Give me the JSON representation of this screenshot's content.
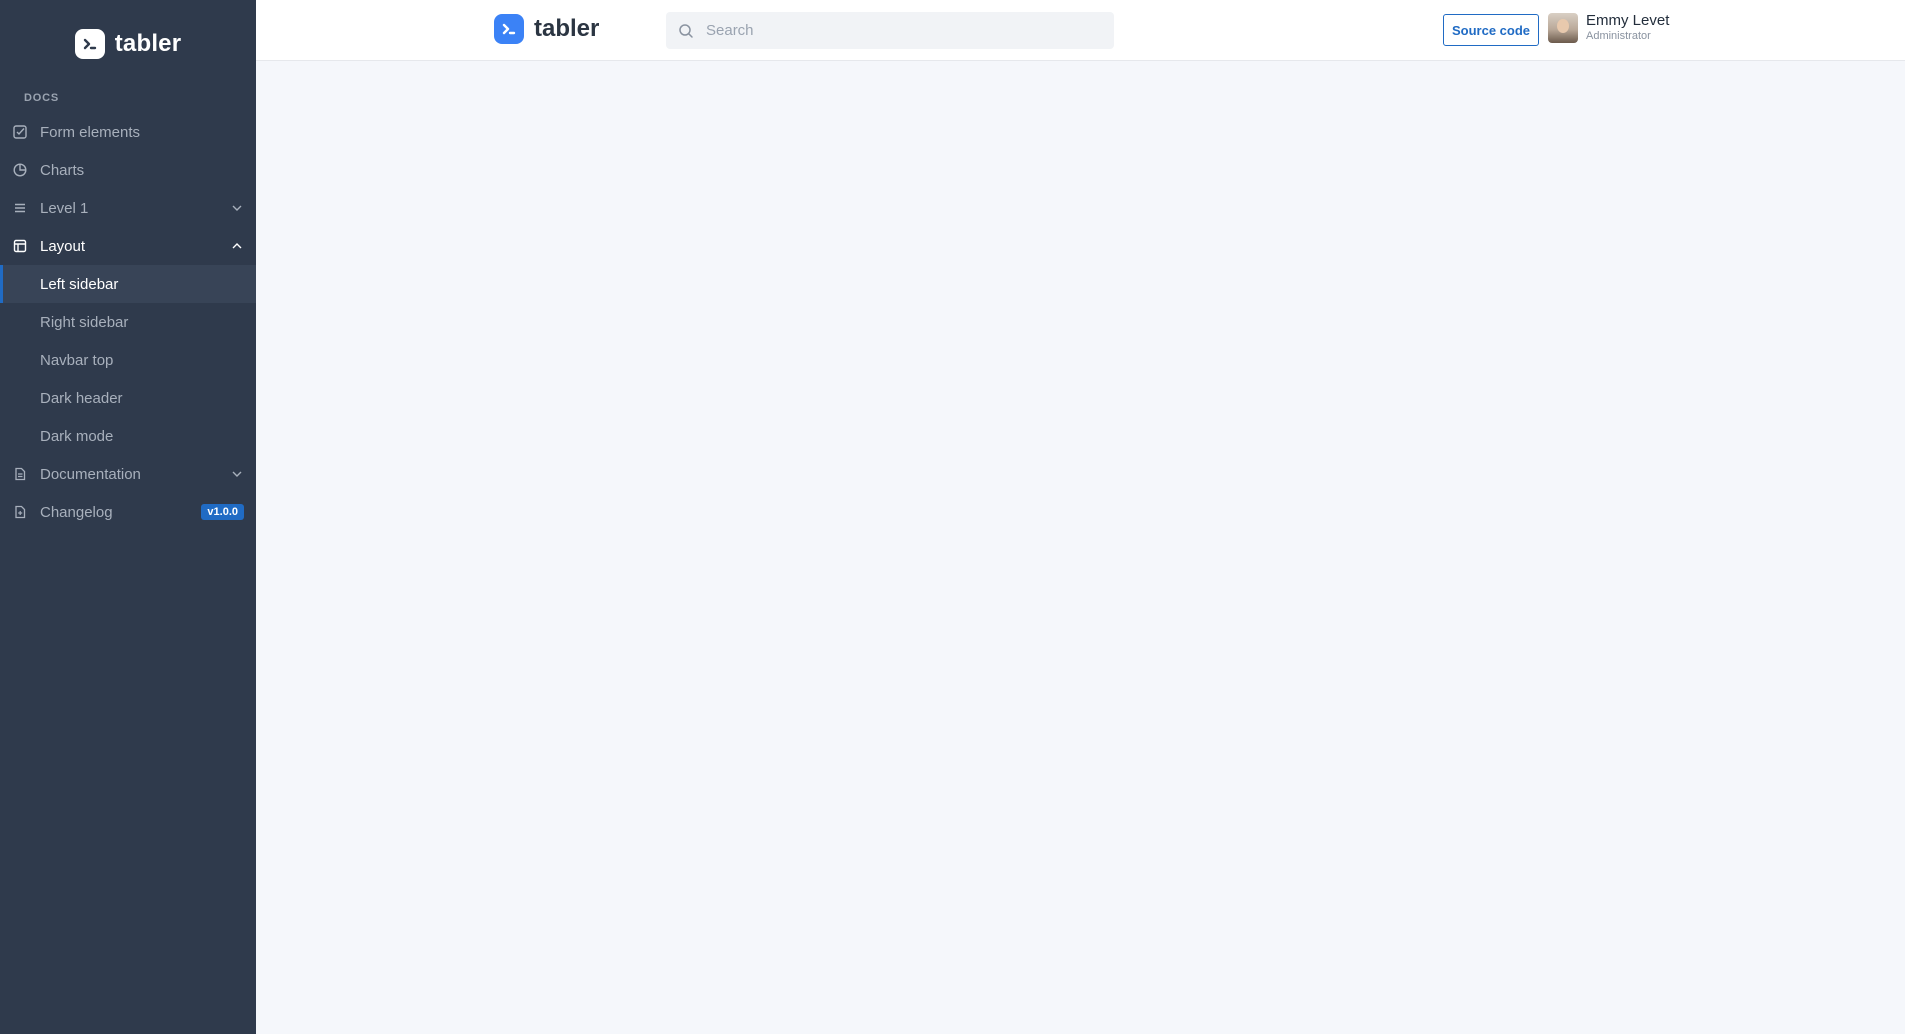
{
  "brand": {
    "name": "tabler"
  },
  "sidebar": {
    "section_title": "Docs",
    "items": [
      {
        "label": "Form elements",
        "icon": "checkbox-icon"
      },
      {
        "label": "Charts",
        "icon": "pie-chart-icon"
      },
      {
        "label": "Level 1",
        "icon": "list-icon",
        "expandable": true
      },
      {
        "label": "Layout",
        "icon": "layout-icon",
        "expandable": true,
        "expanded": true,
        "children": [
          {
            "label": "Left sidebar",
            "active": true
          },
          {
            "label": "Right sidebar"
          },
          {
            "label": "Navbar top"
          },
          {
            "label": "Dark header"
          },
          {
            "label": "Dark mode"
          }
        ]
      },
      {
        "label": "Documentation",
        "icon": "file-text-icon",
        "expandable": true
      },
      {
        "label": "Changelog",
        "icon": "file-plus-icon",
        "badge": "v1.0.0"
      }
    ]
  },
  "header": {
    "brand": "tabler",
    "search": {
      "placeholder": "Search",
      "value": ""
    },
    "source_button": "Source code",
    "user": {
      "name": "Emmy Levet",
      "role": "Administrator"
    }
  },
  "colors": {
    "sidebar_bg": "#2f3a4c",
    "accent": "#206bc4",
    "page_bg": "#f5f7fb"
  }
}
